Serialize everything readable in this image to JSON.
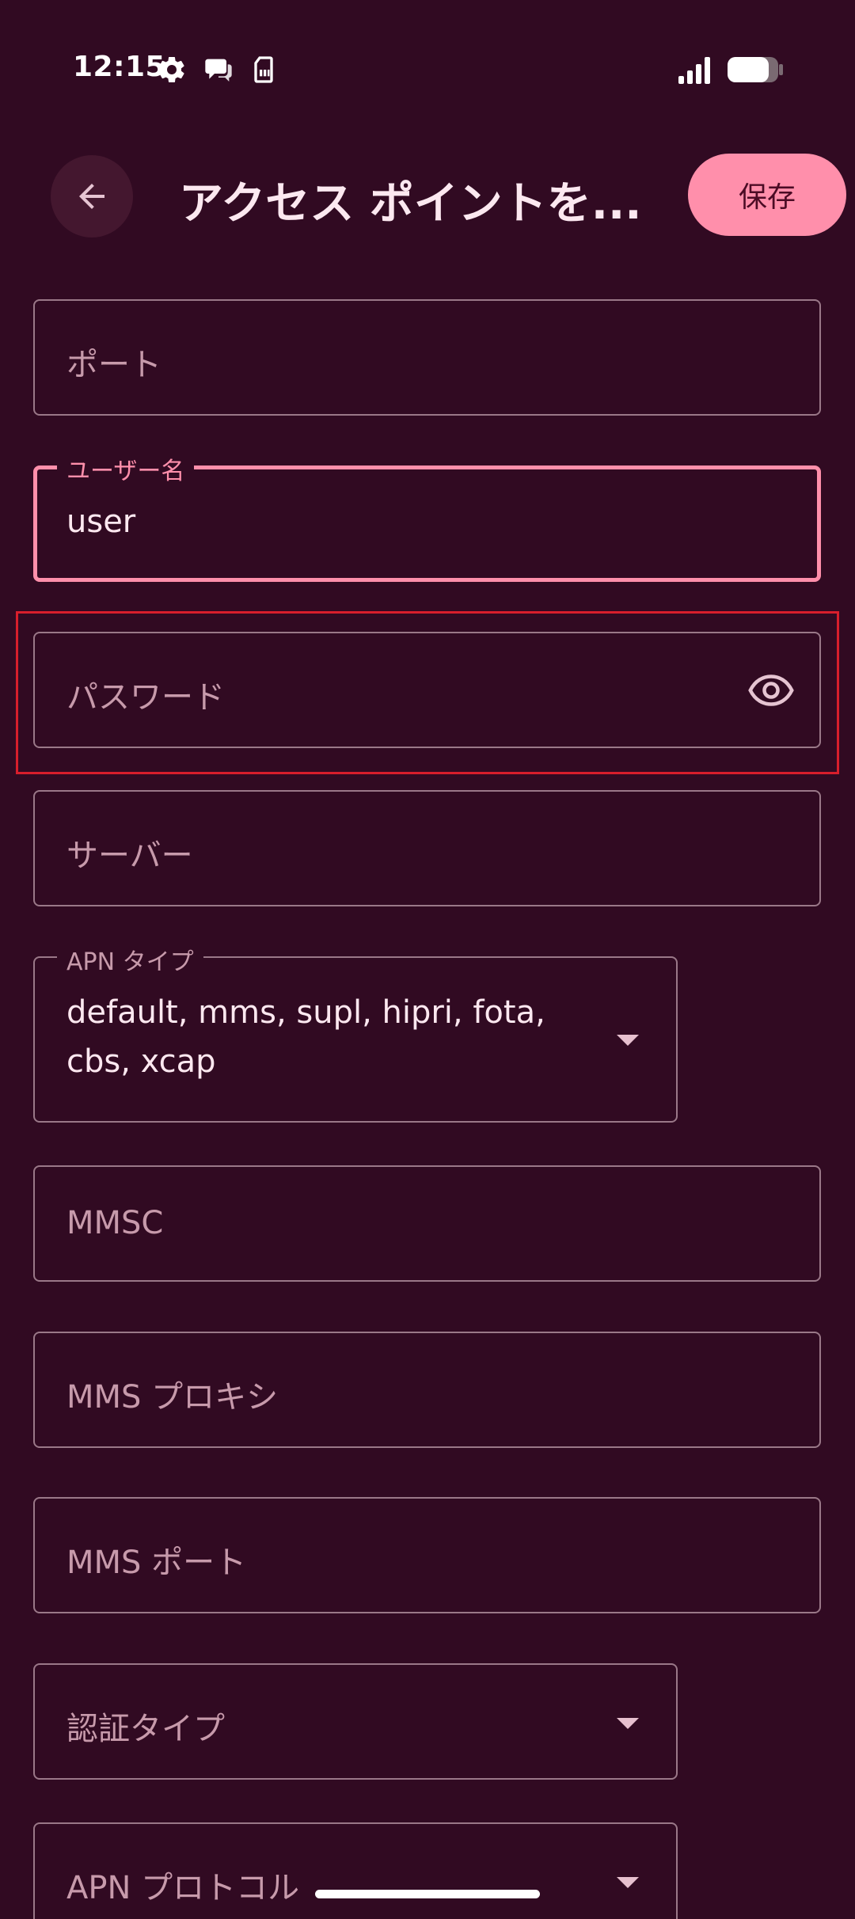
{
  "status_bar": {
    "time": "12:15"
  },
  "app_bar": {
    "title": "アクセス ポイントを...",
    "save_label": "保存"
  },
  "fields": {
    "port": {
      "label": "ポート"
    },
    "username": {
      "label": "ユーザー名",
      "value": "user"
    },
    "password": {
      "label": "パスワード"
    },
    "server": {
      "label": "サーバー"
    },
    "apn_type": {
      "label": "APN タイプ",
      "value_line1": "default, mms, supl, hipri, fota,",
      "value_line2": "cbs, xcap"
    },
    "mmsc": {
      "label": "MMSC"
    },
    "mms_proxy": {
      "label": "MMS プロキシ"
    },
    "mms_port": {
      "label": "MMS ポート"
    },
    "auth_type": {
      "label": "認証タイプ"
    },
    "apn_protocol": {
      "label": "APN プロトコル"
    }
  },
  "colors": {
    "background": "#310a22",
    "accent": "#ff8fab",
    "outline": "#9a7888",
    "highlight": "#d81e2c"
  },
  "icons": {
    "back": "arrow-back-icon",
    "settings": "gear-icon",
    "chat": "chat-bubble-icon",
    "sim": "sim-card-icon",
    "signal": "signal-icon",
    "battery": "battery-icon",
    "visibility": "eye-icon",
    "dropdown": "arrow-drop-down-icon"
  }
}
